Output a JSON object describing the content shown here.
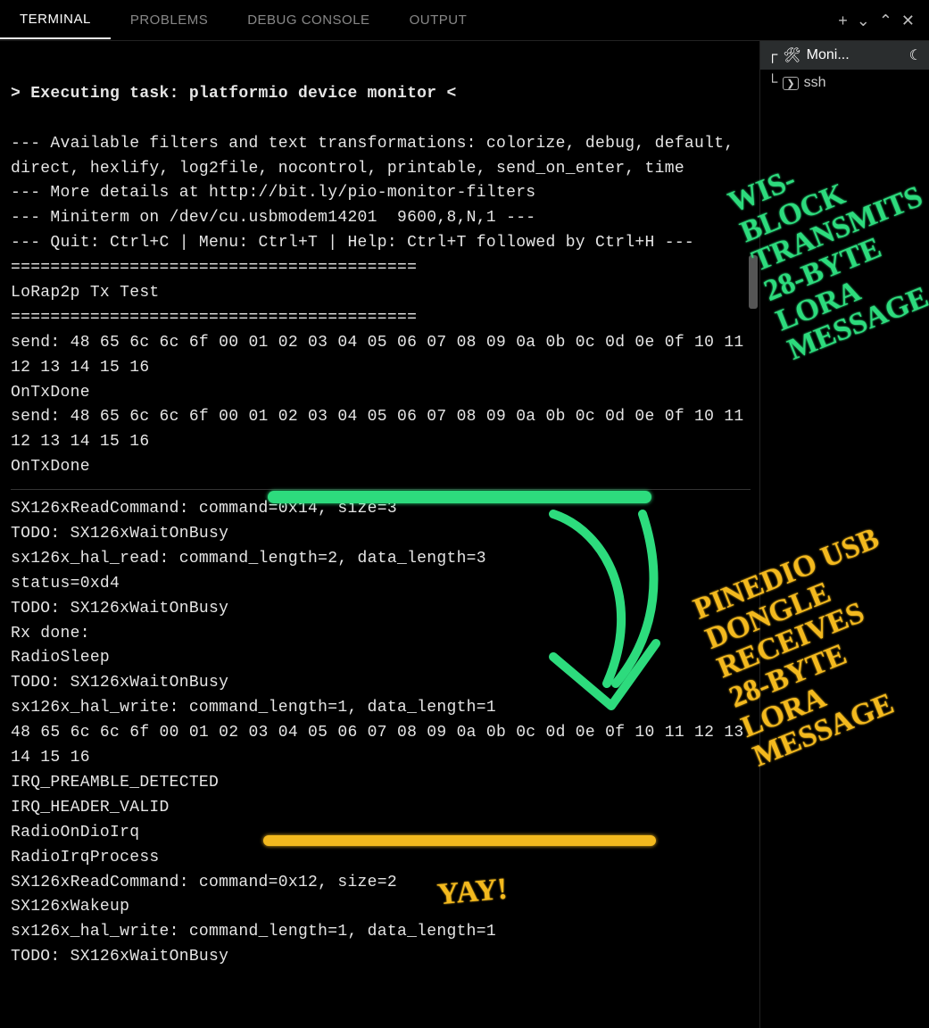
{
  "tabs": {
    "terminal": "TERMINAL",
    "problems": "PROBLEMS",
    "debug_console": "DEBUG CONSOLE",
    "output": "OUTPUT"
  },
  "toolbar": {
    "add": "+",
    "dropdown": "⌄",
    "maximize": "⌃",
    "close": "✕"
  },
  "side": {
    "item1_label": "Moni...",
    "item1_icon": "🛠",
    "item1_tree": "┌",
    "item1_suffix": "☾",
    "item2_label": "ssh",
    "item2_icon": "❯",
    "item2_tree": "└"
  },
  "term": {
    "exec_line": "> Executing task: platformio device monitor <",
    "blank1": "",
    "filters1": "--- Available filters and text transformations: colorize, debug, default, direct, hexlify, log2file, nocontrol, printable, send_on_enter, time",
    "details": "--- More details at http://bit.ly/pio-monitor-filters",
    "miniterm": "--- Miniterm on /dev/cu.usbmodem14201  9600,8,N,1 ---",
    "quit": "--- Quit: Ctrl+C | Menu: Ctrl+T | Help: Ctrl+T followed by Ctrl+H ---",
    "sep1": "=========================================",
    "title": "LoRap2p Tx Test",
    "sep2": "=========================================",
    "send1": "send: 48 65 6c 6c 6f 00 01 02 03 04 05 06 07 08 09 0a 0b 0c 0d 0e 0f 10 11 12 13 14 15 16",
    "ontx1": "OnTxDone",
    "send2": "send: 48 65 6c 6c 6f 00 01 02 03 04 05 06 07 08 09 0a 0b 0c 0d 0e 0f 10 11 12 13 14 15 16",
    "ontx2": "OnTxDone",
    "p1": "SX126xReadCommand: command=0x14, size=3",
    "p2": "TODO: SX126xWaitOnBusy",
    "p3": "sx126x_hal_read: command_length=2, data_length=3",
    "p4": "status=0xd4",
    "p5": "TODO: SX126xWaitOnBusy",
    "p6": "Rx done:",
    "p7": "RadioSleep",
    "p8": "TODO: SX126xWaitOnBusy",
    "p9": "sx126x_hal_write: command_length=1, data_length=1",
    "p10": "48 65 6c 6c 6f 00 01 02 03 04 05 06 07 08 09 0a 0b 0c 0d 0e 0f 10 11 12 13 14 15 16",
    "p11": "IRQ_PREAMBLE_DETECTED",
    "p12": "IRQ_HEADER_VALID",
    "p13": "RadioOnDioIrq",
    "p14": "RadioIrqProcess",
    "p15": "SX126xReadCommand: command=0x12, size=2",
    "p16": "SX126xWakeup",
    "p17": "sx126x_hal_write: command_length=1, data_length=1",
    "p18": "TODO: SX126xWaitOnBusy"
  },
  "annotations": {
    "green_text": "WIS-\nBLOCK\nTRANSMITS\n28-BYTE\nLORA\nMESSAGE",
    "yellow_text": "PINEDIO USB\nDONGLE\nRECEIVES\n28-BYTE\nLORA\nMESSAGE",
    "yay": "YAY!"
  }
}
